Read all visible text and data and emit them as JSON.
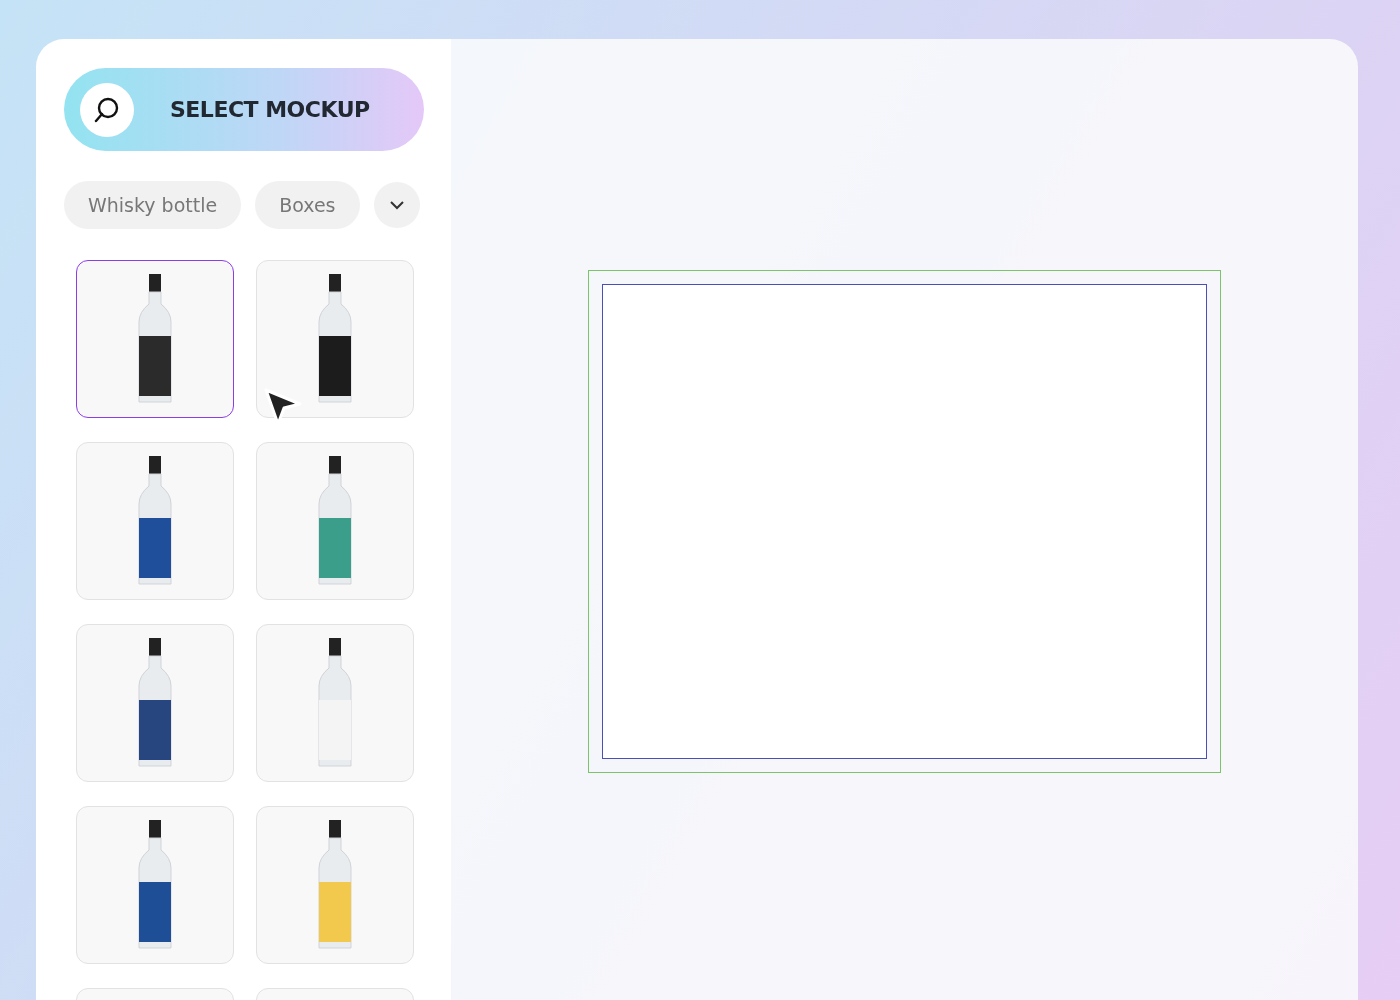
{
  "select_button": {
    "label": "SELECT MOCKUP"
  },
  "categories": [
    {
      "label": "Whisky bottle",
      "selected": false
    },
    {
      "label": "Boxes",
      "selected": false
    }
  ],
  "thumbnails": [
    {
      "selected": true,
      "color": "#2b2b2b"
    },
    {
      "selected": false,
      "color": "#1c1c1c"
    },
    {
      "selected": false,
      "color": "#1f4f9a"
    },
    {
      "selected": false,
      "color": "#3a9e8a"
    },
    {
      "selected": false,
      "color": "#27467f"
    },
    {
      "selected": false,
      "color": "#f4f4f4"
    },
    {
      "selected": false,
      "color": "#1e4f96"
    },
    {
      "selected": false,
      "color": "#f2c94c"
    },
    {
      "selected": false
    },
    {
      "selected": false
    }
  ]
}
